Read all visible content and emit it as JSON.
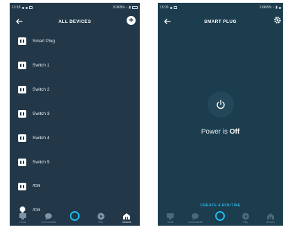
{
  "left": {
    "status": {
      "time": "13:18",
      "speed": "0.0KB/s"
    },
    "header": {
      "title": "ALL DEVICES"
    },
    "devices": [
      {
        "label": "Smart Plug",
        "icon": "plug-icon"
      },
      {
        "label": "Switch 1",
        "icon": "plug-icon"
      },
      {
        "label": "Switch 2",
        "icon": "plug-icon"
      },
      {
        "label": "Switch 3",
        "icon": "plug-icon"
      },
      {
        "label": "Switch 4",
        "icon": "plug-icon"
      },
      {
        "label": "Switch 5",
        "icon": "plug-icon"
      },
      {
        "label": "ЛОМ",
        "icon": "plug-icon"
      },
      {
        "label": "ЛОМ",
        "icon": "bulb-icon"
      }
    ],
    "nav": [
      {
        "label": "Home"
      },
      {
        "label": "Communicate"
      },
      {
        "label": ""
      },
      {
        "label": "Play"
      },
      {
        "label": "Devices"
      }
    ]
  },
  "right": {
    "status": {
      "time": "15:03",
      "speed": "2.6KB/s"
    },
    "header": {
      "title": "SMART PLUG"
    },
    "power": {
      "prefix": "Power is ",
      "state": "Off"
    },
    "routine_label": "CREATE A ROUTINE",
    "nav": [
      {
        "label": "Home"
      },
      {
        "label": "Communicate"
      },
      {
        "label": ""
      },
      {
        "label": "Play"
      },
      {
        "label": "Devices"
      }
    ]
  },
  "colors": {
    "left_bg": "#223849",
    "right_bg": "#1c3d4e",
    "accent": "#1dbff0"
  }
}
